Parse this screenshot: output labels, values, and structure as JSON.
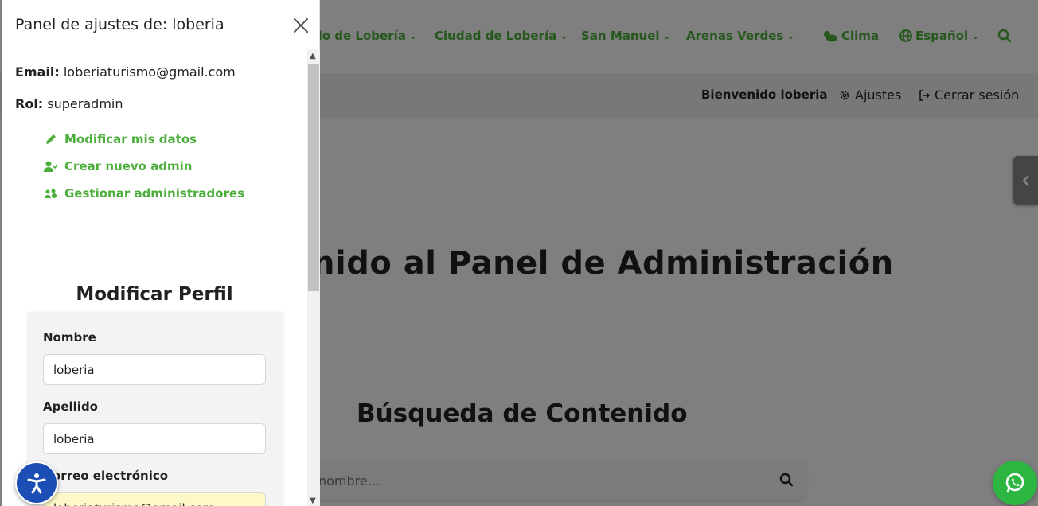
{
  "nav": {
    "items": [
      {
        "label": "do de Lobería"
      },
      {
        "label": "Ciudad de Lobería"
      },
      {
        "label": "San Manuel"
      },
      {
        "label": "Arenas Verdes"
      }
    ],
    "clima": "Clima",
    "language": "Español"
  },
  "userbar": {
    "welcome": "Bienvenido loberia",
    "settings": "Ajustes",
    "logout": "Cerrar sesión"
  },
  "main": {
    "hero_title": "nido al Panel de Administración",
    "search_title": "Búsqueda de Contenido",
    "search_placeholder": "nombre..."
  },
  "panel": {
    "title": "Panel de ajustes de: loberia",
    "email_label": "Email:",
    "email_value": "loberiaturismo@gmail.com",
    "role_label": "Rol:",
    "role_value": "superadmin",
    "links": {
      "edit": "Modificar mis datos",
      "create": "Crear nuevo admin",
      "manage": "Gestionar administradores"
    },
    "form": {
      "title": "Modificar Perfil",
      "nombre_label": "Nombre",
      "nombre_value": "loberia",
      "apellido_label": "Apellido",
      "apellido_value": "loberia",
      "email_label": "orreo electrónico",
      "email_value": "loberiaturismo@gmail.com"
    }
  },
  "colors": {
    "accent_green": "#4cae3b",
    "whatsapp_green": "#2db742",
    "a11y_blue": "#1b4fb6"
  }
}
